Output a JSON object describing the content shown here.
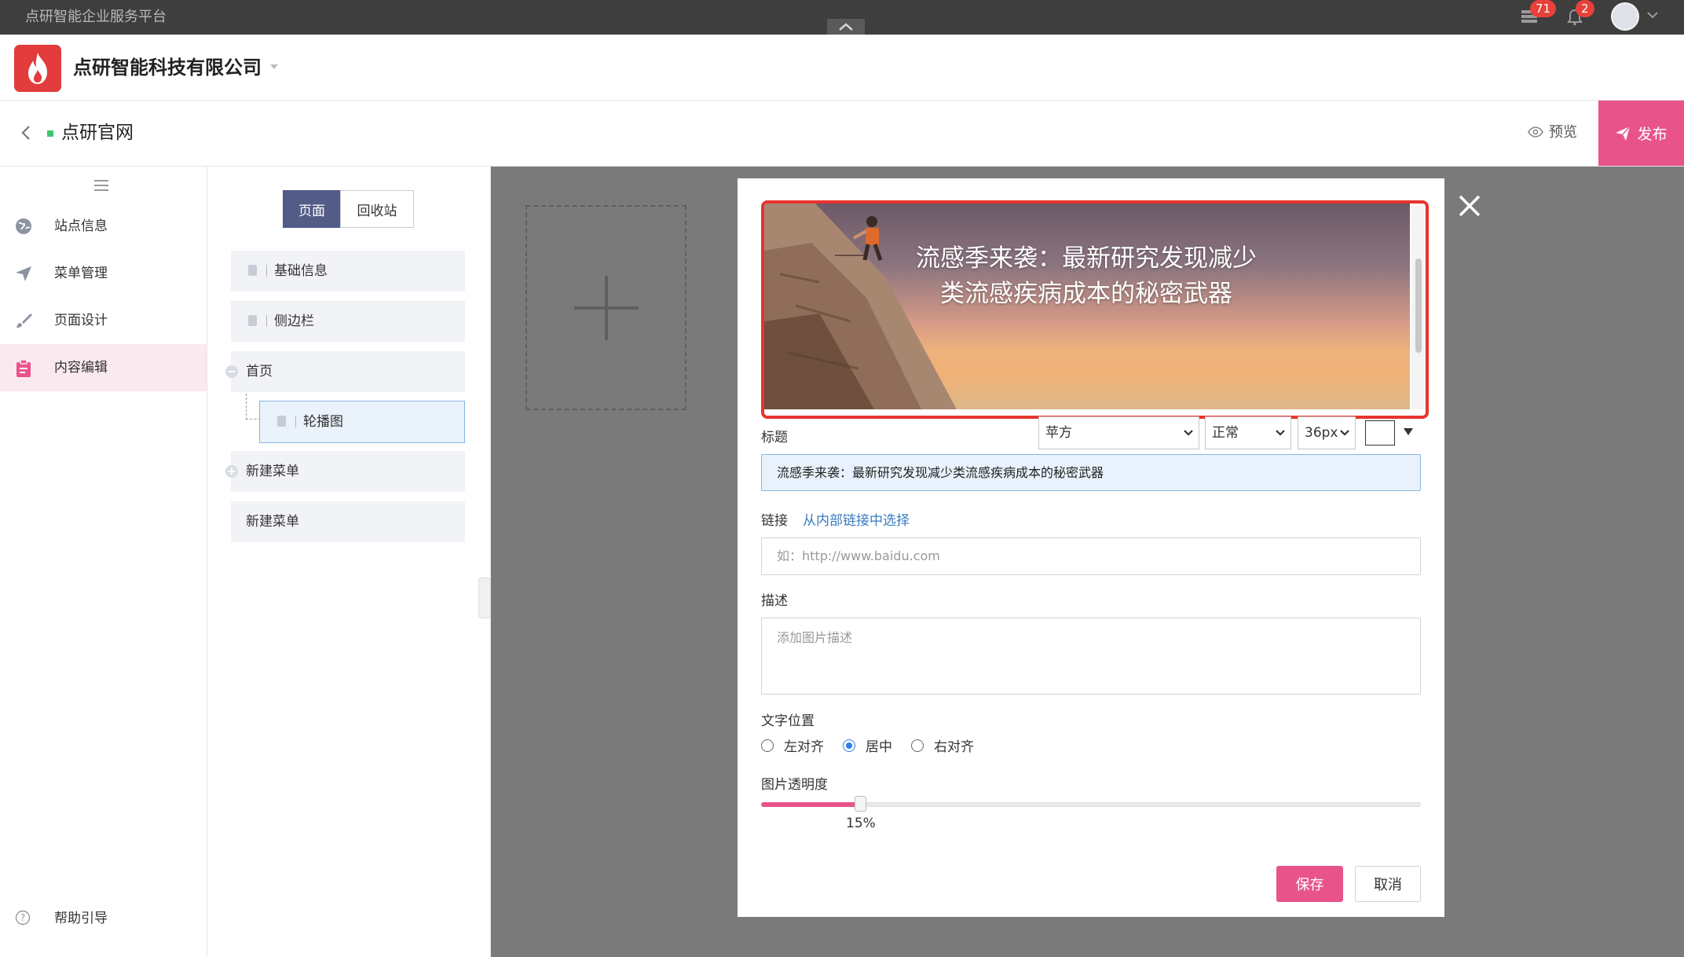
{
  "topbar": {
    "title": "点研智能企业服务平台",
    "messages_badge": "71",
    "notifications_badge": "2"
  },
  "header": {
    "company_name": "点研智能科技有限公司"
  },
  "sitebar": {
    "site_name": "点研官网",
    "preview_label": "预览",
    "publish_label": "发布"
  },
  "sidebar": {
    "items": [
      {
        "label": "站点信息",
        "icon": "globe-icon"
      },
      {
        "label": "菜单管理",
        "icon": "send-icon"
      },
      {
        "label": "页面设计",
        "icon": "brush-icon"
      },
      {
        "label": "内容编辑",
        "icon": "clipboard-icon",
        "active": true
      }
    ],
    "help_label": "帮助引导"
  },
  "tree": {
    "tabs": [
      {
        "label": "页面",
        "active": true
      },
      {
        "label": "回收站",
        "active": false
      }
    ],
    "items": [
      {
        "label": "基础信息"
      },
      {
        "label": "侧边栏"
      },
      {
        "label": "首页"
      },
      {
        "label": "轮播图"
      },
      {
        "label": "新建菜单"
      },
      {
        "label": "新建菜单"
      }
    ]
  },
  "modal": {
    "banner_title": "流感季来袭：最新研究发现减少类流感疾病成本的秘密武器",
    "title_label": "标题",
    "font_family": "苹方",
    "font_weight": "正常",
    "font_size": "36px",
    "title_value": "流感季来袭：最新研究发现减少类流感疾病成本的秘密武器",
    "link_label": "链接",
    "link_internal": "从内部链接中选择",
    "link_placeholder": "如：http://www.baidu.com",
    "desc_label": "描述",
    "desc_placeholder": "添加图片描述",
    "text_position_label": "文字位置",
    "positions": [
      {
        "label": "左对齐",
        "checked": false
      },
      {
        "label": "居中",
        "checked": true
      },
      {
        "label": "右对齐",
        "checked": false
      }
    ],
    "opacity_label": "图片透明度",
    "opacity_percent": 15,
    "opacity_text": "15%",
    "save_label": "保存",
    "cancel_label": "取消"
  },
  "colors": {
    "accent": "#e8548a",
    "danger": "#e23c3c",
    "active_tab": "#535c87"
  }
}
